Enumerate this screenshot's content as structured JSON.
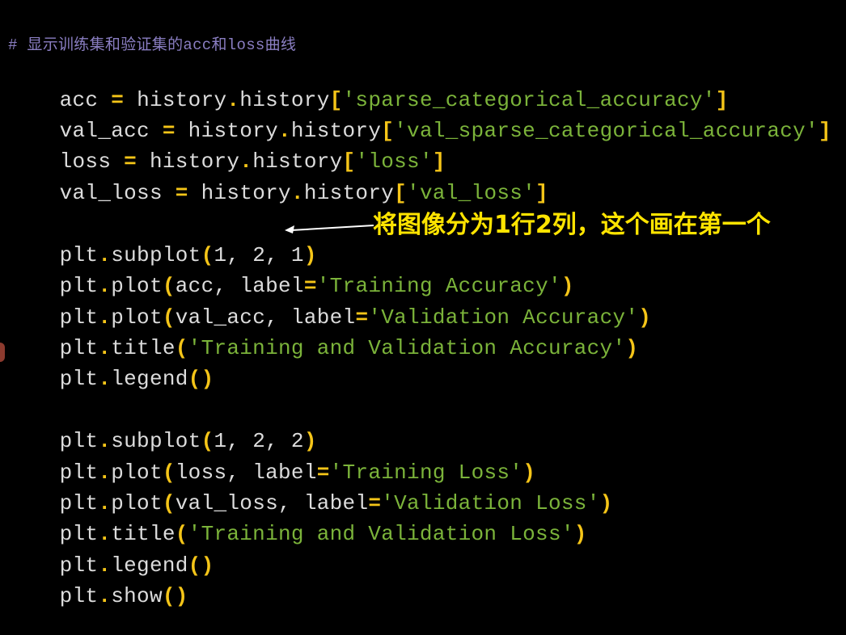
{
  "editor": {
    "comment": "# 显示训练集和验证集的acc和loss曲线",
    "lines": [
      [
        "acc",
        " = ",
        "history",
        ".",
        "history",
        "[",
        "'sparse_categorical_accuracy'",
        "]"
      ],
      [
        "val_acc",
        " = ",
        "history",
        ".",
        "history",
        "[",
        "'val_sparse_categorical_accuracy'",
        "]"
      ],
      [
        "loss",
        " = ",
        "history",
        ".",
        "history",
        "[",
        "'loss'",
        "]"
      ],
      [
        "val_loss",
        " = ",
        "history",
        ".",
        "history",
        "[",
        "'val_loss'",
        "]"
      ]
    ],
    "block1": {
      "subplot": {
        "obj": "plt",
        "fn": "subplot",
        "args": "1, 2, 1"
      },
      "plot1": {
        "obj": "plt",
        "fn": "plot",
        "arg": "acc",
        "kw": "label",
        "val": "'Training Accuracy'"
      },
      "plot2": {
        "obj": "plt",
        "fn": "plot",
        "arg": "val_acc",
        "kw": "label",
        "val": "'Validation Accuracy'"
      },
      "title": {
        "obj": "plt",
        "fn": "title",
        "val": "'Training and Validation Accuracy'"
      },
      "legend": {
        "obj": "plt",
        "fn": "legend"
      }
    },
    "block2": {
      "subplot": {
        "obj": "plt",
        "fn": "subplot",
        "args": "1, 2, 2"
      },
      "plot1": {
        "obj": "plt",
        "fn": "plot",
        "arg": "loss",
        "kw": "label",
        "val": "'Training Loss'"
      },
      "plot2": {
        "obj": "plt",
        "fn": "plot",
        "arg": "val_loss",
        "kw": "label",
        "val": "'Validation Loss'"
      },
      "title": {
        "obj": "plt",
        "fn": "title",
        "val": "'Training and Validation Loss'"
      },
      "legend": {
        "obj": "plt",
        "fn": "legend"
      },
      "show": {
        "obj": "plt",
        "fn": "show"
      }
    }
  },
  "annotation": {
    "text": "将图像分为1行2列，这个画在第一个",
    "color": "#ffe400"
  },
  "colors": {
    "background": "#000000",
    "identifier": "#dcdcdc",
    "operator": "#f5c518",
    "string": "#7bb33a",
    "comment": "#8a7ec2"
  }
}
